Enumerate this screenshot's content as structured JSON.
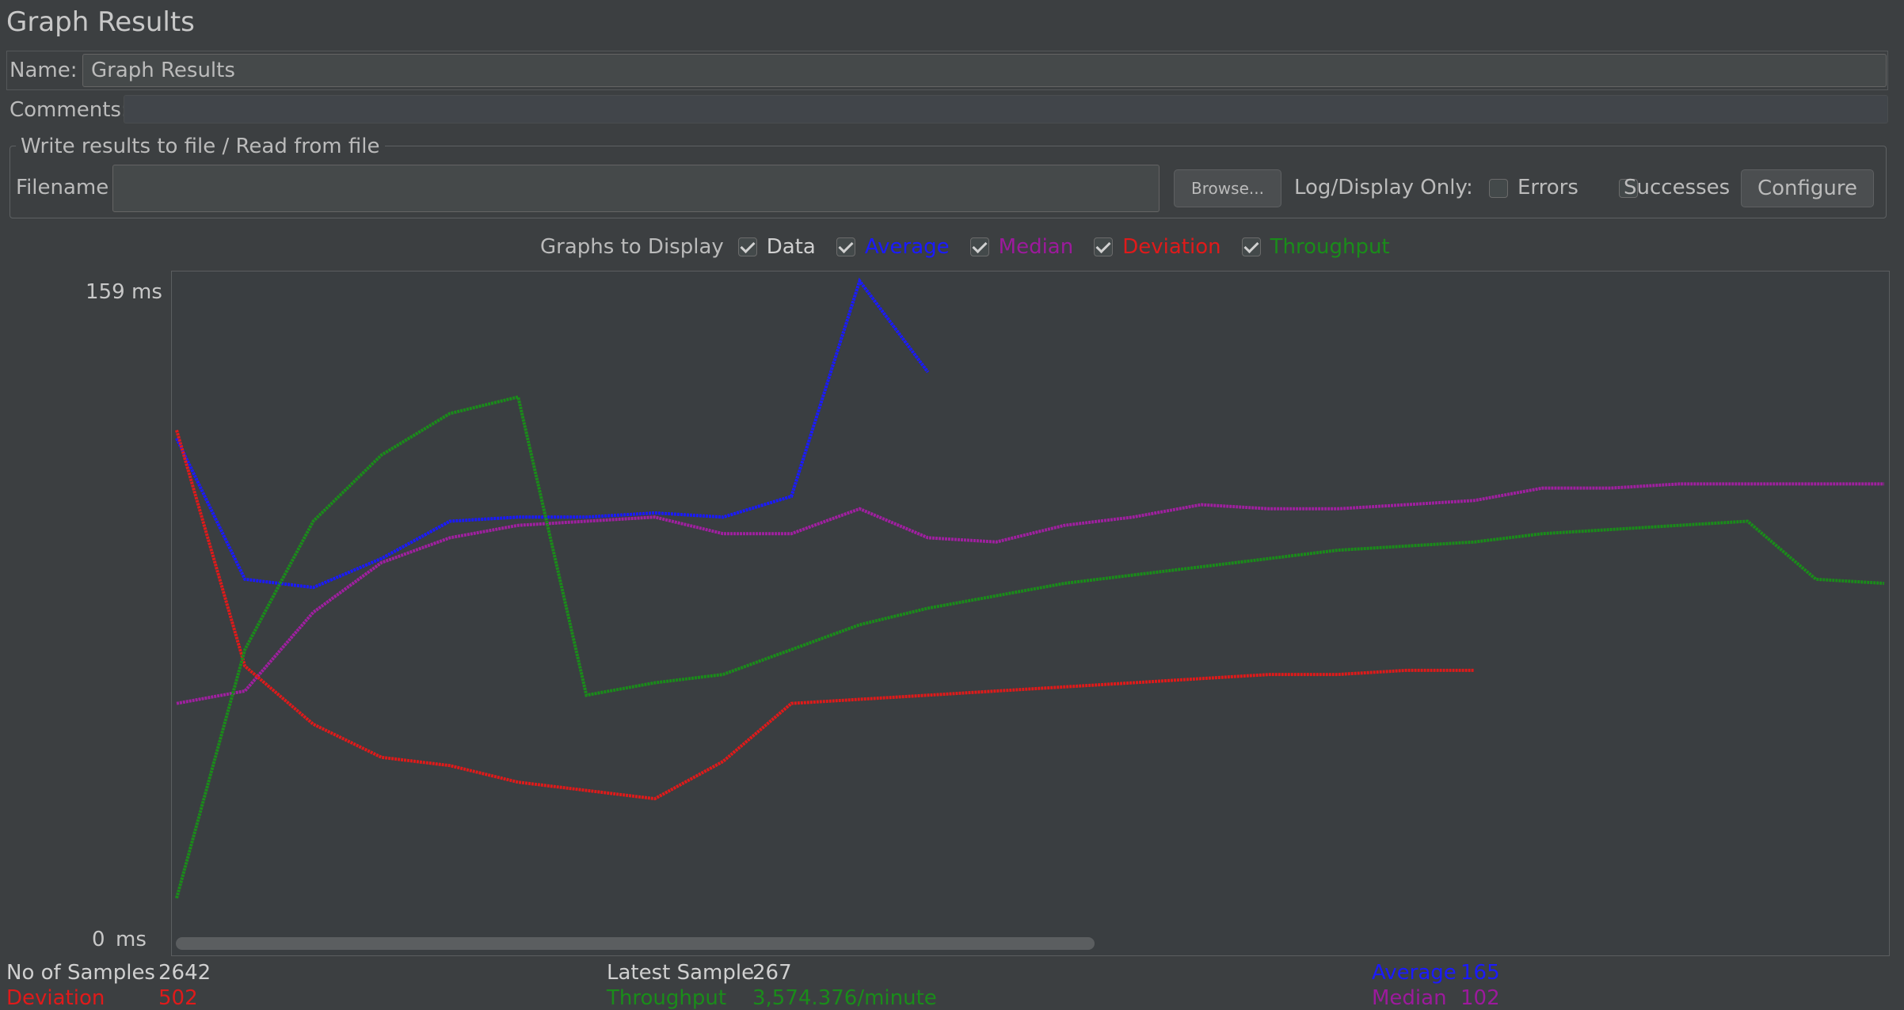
{
  "panel": {
    "title": "Graph Results",
    "name_label": "Name:",
    "name_value": "Graph Results",
    "comments_label": "Comments:",
    "comments_value": ""
  },
  "file_section": {
    "legend": "Write results to file / Read from file",
    "filename_label": "Filename",
    "filename_value": "",
    "browse_label": "Browse...",
    "log_display_label": "Log/Display Only:",
    "errors_label": "Errors",
    "errors_checked": false,
    "successes_label": "Successes",
    "successes_checked": false,
    "configure_label": "Configure"
  },
  "graphs_to_display": {
    "label": "Graphs to Display",
    "options": [
      {
        "label": "Data",
        "checked": true,
        "color": "#d0d0d0"
      },
      {
        "label": "Average",
        "checked": true,
        "color": "#1a1aff"
      },
      {
        "label": "Median",
        "checked": true,
        "color": "#9c1a9c"
      },
      {
        "label": "Deviation",
        "checked": true,
        "color": "#e01a1a"
      },
      {
        "label": "Throughput",
        "checked": true,
        "color": "#1a8c1a"
      }
    ]
  },
  "axis": {
    "top_value": "159",
    "top_unit": "ms",
    "bottom_value": "0",
    "bottom_unit": "ms"
  },
  "stats": {
    "samples_label": "No of Samples",
    "samples_value": "2642",
    "deviation_label": "Deviation",
    "deviation_value": "502",
    "latest_label": "Latest Sample",
    "latest_value": "267",
    "throughput_label": "Throughput",
    "throughput_value": "3,574.376/minute",
    "average_label": "Average",
    "average_value": "165",
    "median_label": "Median",
    "median_value": "102"
  },
  "colors": {
    "data": "#ffff33",
    "average": "#1a1aff",
    "median": "#a020a0",
    "deviation": "#e01a1a",
    "throughput": "#1a8c1a"
  },
  "chart_data": {
    "type": "line",
    "ylim": [
      0,
      159
    ],
    "y_unit": "ms",
    "x": [
      0,
      4,
      8,
      12,
      16,
      20,
      24,
      28,
      32,
      36,
      40,
      44,
      48,
      52,
      56,
      60,
      64,
      68,
      72,
      76,
      80,
      84,
      88,
      92,
      96,
      100
    ],
    "series": [
      {
        "name": "Average",
        "values": [
          121,
          87,
          85,
          92,
          101,
          102,
          102,
          103,
          102,
          107,
          159,
          137,
          null,
          null,
          null,
          null,
          null,
          null,
          null,
          null,
          null,
          null,
          null,
          null,
          null,
          null
        ]
      },
      {
        "name": "Median",
        "values": [
          57,
          60,
          79,
          91,
          97,
          100,
          101,
          102,
          98,
          98,
          104,
          97,
          96,
          100,
          102,
          105,
          104,
          104,
          105,
          106,
          109,
          109,
          110,
          110,
          110,
          110
        ]
      },
      {
        "name": "Deviation",
        "values": [
          123,
          66,
          52,
          44,
          42,
          38,
          36,
          34,
          43,
          57,
          58,
          59,
          60,
          61,
          62,
          63,
          64,
          64,
          65,
          65,
          null,
          null,
          null,
          null,
          null,
          null
        ]
      },
      {
        "name": "Throughput",
        "values": [
          10,
          70,
          101,
          117,
          127,
          131,
          59,
          62,
          64,
          70,
          76,
          80,
          83,
          86,
          88,
          90,
          92,
          94,
          95,
          96,
          98,
          99,
          100,
          101,
          87,
          86
        ]
      }
    ]
  }
}
